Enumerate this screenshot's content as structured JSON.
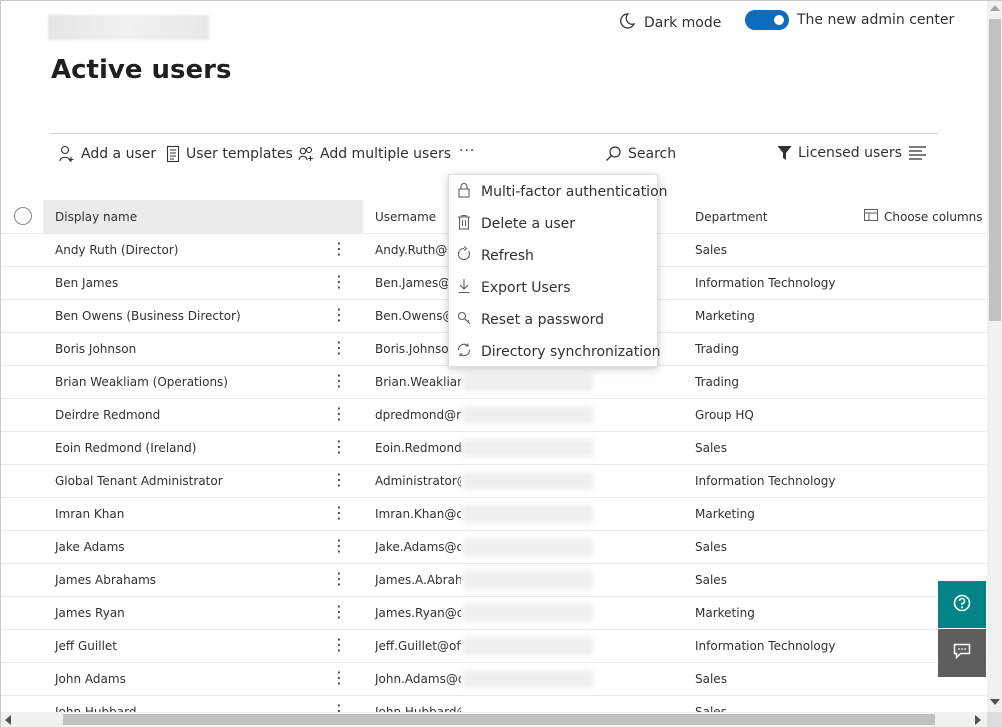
{
  "header": {
    "dark_mode_label": "Dark mode",
    "admin_center_label": "The new admin center",
    "admin_center_enabled": true,
    "accent_color": "#0f6cbd"
  },
  "page": {
    "title": "Active users"
  },
  "toolbar": {
    "add_user": "Add a user",
    "user_templates": "User templates",
    "add_multiple_users": "Add multiple users",
    "more": "···",
    "search": "Search",
    "filter": "Licensed users"
  },
  "table": {
    "columns": {
      "display_name": "Display name",
      "username": "Username",
      "department": "Department",
      "choose_columns": "Choose columns"
    },
    "rows": [
      {
        "name": "Andy Ruth (Director)",
        "username": "Andy.Ruth@o",
        "department": "Sales"
      },
      {
        "name": "Ben James",
        "username": "Ben.James@O",
        "department": "Information Technology"
      },
      {
        "name": "Ben Owens (Business Director)",
        "username": "Ben.Owens@o",
        "department": "Marketing"
      },
      {
        "name": "Boris Johnson",
        "username": "Boris.Johnson",
        "department": "Trading"
      },
      {
        "name": "Brian Weakliam (Operations)",
        "username": "Brian.Weakliam@",
        "department": "Trading"
      },
      {
        "name": "Deirdre Redmond",
        "username": "dpredmond@re",
        "department": "Group HQ"
      },
      {
        "name": "Eoin Redmond (Ireland)",
        "username": "Eoin.Redmond@",
        "department": "Sales"
      },
      {
        "name": "Global Tenant Administrator",
        "username": "Administrator@",
        "department": "Information Technology"
      },
      {
        "name": "Imran Khan",
        "username": "Imran.Khan@off",
        "department": "Marketing"
      },
      {
        "name": "Jake Adams",
        "username": "Jake.Adams@off",
        "department": "Sales"
      },
      {
        "name": "James Abrahams",
        "username": "James.A.Abrahar",
        "department": "Sales"
      },
      {
        "name": "James Ryan",
        "username": "James.Ryan@off",
        "department": "Marketing"
      },
      {
        "name": "Jeff Guillet",
        "username": "Jeff.Guillet@offic",
        "department": "Information Technology"
      },
      {
        "name": "John Adams",
        "username": "John.Adams@of",
        "department": "Sales"
      },
      {
        "name": "John Hubbard",
        "username": "John.Hubbard@",
        "department": "Sales"
      }
    ]
  },
  "more_menu": {
    "items": [
      {
        "label": "Multi-factor authentication",
        "icon": "lock-icon"
      },
      {
        "label": "Delete a user",
        "icon": "trash-icon"
      },
      {
        "label": "Refresh",
        "icon": "refresh-icon"
      },
      {
        "label": "Export Users",
        "icon": "download-icon"
      },
      {
        "label": "Reset a password",
        "icon": "key-icon"
      },
      {
        "label": "Directory synchronization",
        "icon": "sync-icon"
      }
    ]
  },
  "floating": {
    "help_color": "#038387",
    "feedback_color": "#605e5c"
  }
}
